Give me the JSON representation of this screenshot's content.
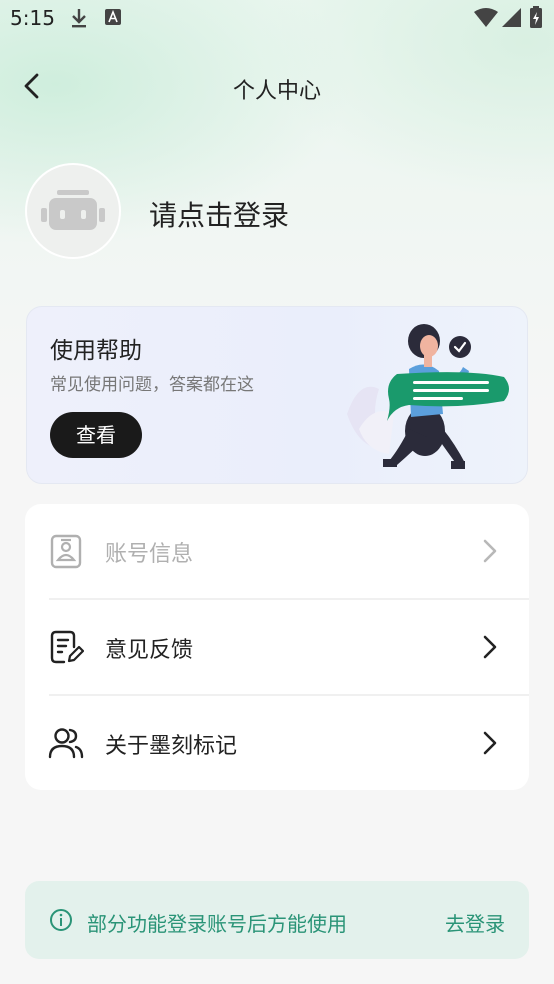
{
  "status_bar": {
    "time": "5:15",
    "icons": [
      "download-icon",
      "a-icon",
      "wifi-icon",
      "signal-icon",
      "battery-icon"
    ]
  },
  "nav": {
    "title": "个人中心"
  },
  "profile": {
    "login_prompt": "请点击登录"
  },
  "help_card": {
    "title": "使用帮助",
    "subtitle": "常见使用问题，答案都在这",
    "button_label": "查看"
  },
  "menu": {
    "items": [
      {
        "label": "账号信息",
        "icon": "id-card-icon",
        "disabled": true
      },
      {
        "label": "意见反馈",
        "icon": "feedback-edit-icon",
        "disabled": false
      },
      {
        "label": "关于墨刻标记",
        "icon": "users-icon",
        "disabled": false
      }
    ]
  },
  "login_banner": {
    "text": "部分功能登录账号后方能使用",
    "link": "去登录"
  },
  "colors": {
    "accent_green": "#2a9477",
    "banner_bg": "#e3f1ec",
    "illustration_green": "#1a9a6c",
    "button_dark": "#1a1a1a"
  }
}
